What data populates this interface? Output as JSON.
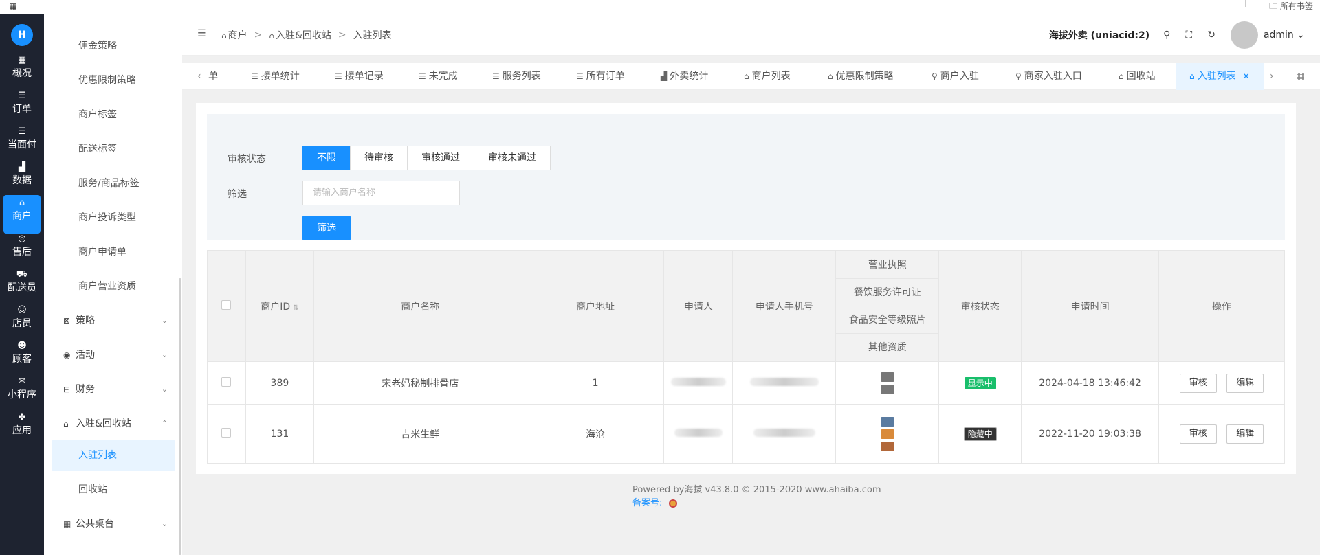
{
  "topstrip": {
    "bookmarks_label": "所有书签"
  },
  "rail": {
    "items": [
      {
        "icon": "dashboard-icon",
        "label": "概况"
      },
      {
        "icon": "list-icon",
        "label": "订单"
      },
      {
        "icon": "list-icon",
        "label": "当面付"
      },
      {
        "icon": "bar-chart-icon",
        "label": "数据"
      },
      {
        "icon": "store-icon",
        "label": "商户"
      },
      {
        "icon": "headset-icon",
        "label": "售后"
      },
      {
        "icon": "scooter-icon",
        "label": "配送员"
      },
      {
        "icon": "user-icon",
        "label": "店员"
      },
      {
        "icon": "customer-icon",
        "label": "顾客"
      },
      {
        "icon": "chat-icon",
        "label": "小程序"
      },
      {
        "icon": "apps-icon",
        "label": "应用"
      }
    ]
  },
  "side": {
    "items": [
      {
        "label": "佣金策略"
      },
      {
        "label": "优惠限制策略"
      },
      {
        "label": "商户标签"
      },
      {
        "label": "配送标签"
      },
      {
        "label": "服务/商品标签"
      },
      {
        "label": "商户投诉类型"
      },
      {
        "label": "商户申请单"
      },
      {
        "label": "商户营业资质"
      }
    ],
    "groups": [
      {
        "icon": "strategy-icon",
        "label": "策略"
      },
      {
        "icon": "activity-icon",
        "label": "活动"
      },
      {
        "icon": "finance-icon",
        "label": "财务"
      },
      {
        "icon": "store-icon",
        "label": "入驻&回收站"
      }
    ],
    "sub_items": [
      {
        "label": "入驻列表"
      },
      {
        "label": "回收站"
      }
    ],
    "last_group": {
      "icon": "table-icon",
      "label": "公共桌台"
    }
  },
  "header": {
    "breadcrumb": [
      "商户",
      "入驻&回收站",
      "入驻列表"
    ],
    "store_name": "海拔外卖 (uniacid:2)",
    "username": "admin"
  },
  "tabs": [
    {
      "icon": "list-icon",
      "label": "单"
    },
    {
      "icon": "list-icon",
      "label": "接单统计"
    },
    {
      "icon": "list-icon",
      "label": "接单记录"
    },
    {
      "icon": "list-icon",
      "label": "未完成"
    },
    {
      "icon": "list-icon",
      "label": "服务列表"
    },
    {
      "icon": "list-icon",
      "label": "所有订单"
    },
    {
      "icon": "bar-chart-icon",
      "label": "外卖统计"
    },
    {
      "icon": "store-icon",
      "label": "商户列表"
    },
    {
      "icon": "store-icon",
      "label": "优惠限制策略"
    },
    {
      "icon": "user-icon",
      "label": "商户入驻"
    },
    {
      "icon": "user-icon",
      "label": "商家入驻入口"
    },
    {
      "icon": "store-icon",
      "label": "回收站"
    },
    {
      "icon": "store-icon",
      "label": "入驻列表"
    }
  ],
  "filter": {
    "status_label": "审核状态",
    "status_options": [
      "不限",
      "待审核",
      "审核通过",
      "审核未通过"
    ],
    "selected_status": "不限",
    "search_label": "筛选",
    "search_placeholder": "请输入商户名称",
    "submit_label": "筛选"
  },
  "table": {
    "headers": {
      "id": "商户ID",
      "name": "商户名称",
      "address": "商户地址",
      "applicant": "申请人",
      "phone": "申请人手机号",
      "qualifications": [
        "营业执照",
        "餐饮服务许可证",
        "食品安全等级照片",
        "其他资质"
      ],
      "status": "审核状态",
      "time": "申请时间",
      "actions": "操作"
    },
    "rows": [
      {
        "id": "389",
        "name": "宋老妈秘制排骨店",
        "address": "1",
        "status": "显示中",
        "time": "2024-04-18 13:46:42",
        "review": "审核",
        "edit": "编辑"
      },
      {
        "id": "131",
        "name": "吉米生鲜",
        "address": "海沧",
        "status": "隐藏中",
        "time": "2022-11-20 19:03:38",
        "review": "审核",
        "edit": "编辑"
      }
    ]
  },
  "footer": {
    "powered": "Powered by海拔 v43.8.0 © 2015-2020 www.ahaiba.com",
    "beian": "备案号:"
  },
  "colors": {
    "primary": "#1890ff",
    "rail_bg": "#1e2330",
    "success": "#19be6b"
  }
}
